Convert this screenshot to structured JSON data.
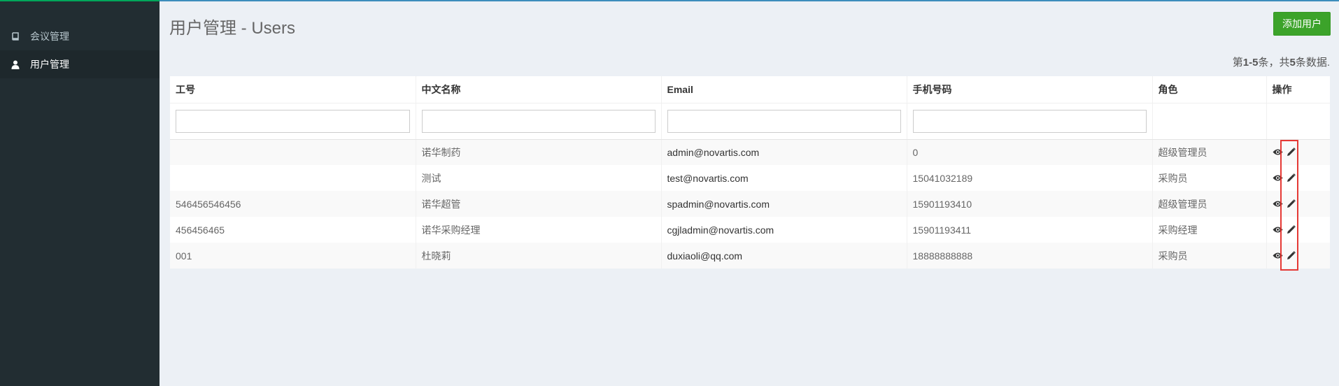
{
  "sidebar": {
    "items": [
      {
        "label": "会议管理",
        "icon": "book-icon",
        "active": false
      },
      {
        "label": "用户管理",
        "icon": "user-icon",
        "active": true
      }
    ]
  },
  "header": {
    "title": "用户管理 - Users",
    "add_button": "添加用户"
  },
  "summary": {
    "prefix": "第",
    "range": "1-5",
    "mid": "条，共",
    "total": "5",
    "suffix": "条数据."
  },
  "table": {
    "columns": [
      "工号",
      "中文名称",
      "Email",
      "手机号码",
      "角色",
      "操作"
    ],
    "filters": {
      "id": "",
      "name": "",
      "email": "",
      "phone": ""
    },
    "rows": [
      {
        "id": "",
        "name": "诺华制药",
        "email": "admin@novartis.com",
        "phone": "0",
        "role": "超级管理员"
      },
      {
        "id": "",
        "name": "测试",
        "email": "test@novartis.com",
        "phone": "15041032189",
        "role": "采购员"
      },
      {
        "id": "546456546456",
        "name": "诺华超管",
        "email": "spadmin@novartis.com",
        "phone": "15901193410",
        "role": "超级管理员"
      },
      {
        "id": "456456465",
        "name": "诺华采购经理",
        "email": "cgjladmin@novartis.com",
        "phone": "15901193411",
        "role": "采购经理"
      },
      {
        "id": "001",
        "name": "杜晓莉",
        "email": "duxiaoli@qq.com",
        "phone": "18888888888",
        "role": "采购员"
      }
    ],
    "row_actions": [
      "eye-icon",
      "pencil-icon"
    ]
  },
  "colors": {
    "sidebar_bg": "#222d32",
    "sidebar_active": "#1e282c",
    "content_bg": "#ecf0f5",
    "add_button": "#3ca32a",
    "highlight": "#e53935"
  }
}
